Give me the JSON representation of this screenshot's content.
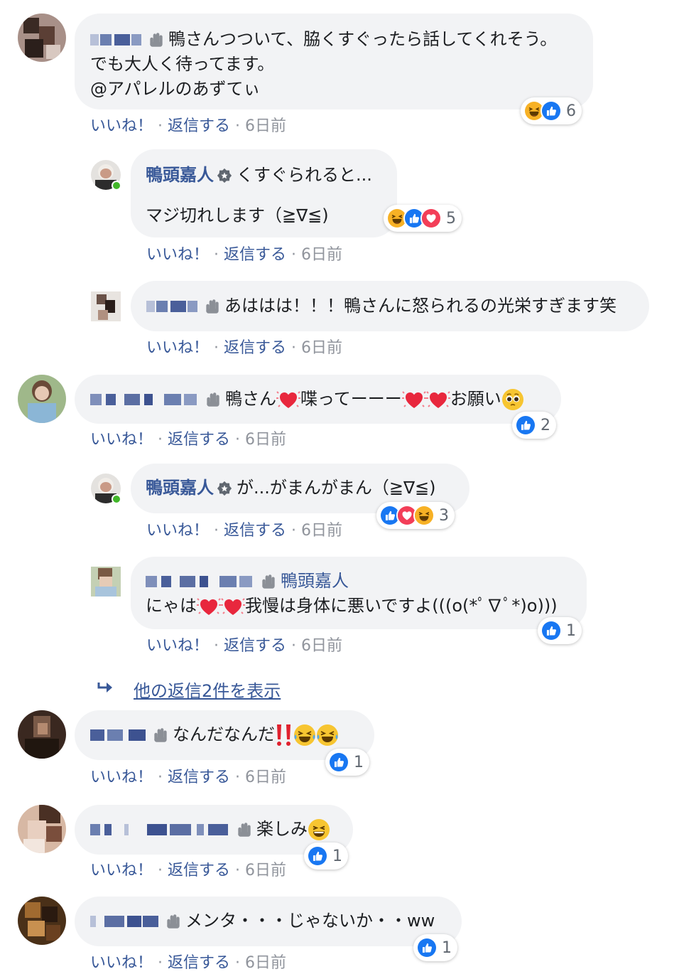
{
  "colors": {
    "link": "#385898",
    "meta": "#90949c",
    "bubble": "#f2f3f5",
    "like": "#1877f2",
    "love": "#f33e58",
    "haha": "#f7b125",
    "online": "#42b72a"
  },
  "actions": {
    "like_label": "いいね！",
    "reply_label": "返信する",
    "separator": "·",
    "time": "6日前"
  },
  "comments": [
    {
      "line1": "鴨さんつついて、脇くすぐったら話してくれそう。",
      "line2": "でも大人く待ってます。",
      "line3": "@アパレルのあずてぃ",
      "reaction_count": "6",
      "reaction_icons": [
        "haha",
        "like"
      ]
    },
    {
      "author": "鴨頭嘉人",
      "line1": "くすぐられると...",
      "line2": "マジ切れします（≧∇≦)",
      "reaction_count": "5",
      "reaction_icons": [
        "haha",
        "like",
        "love"
      ]
    },
    {
      "text": "あははは！！！鴨さんに怒られるの光栄すぎます笑"
    },
    {
      "text_a": "鴨さん",
      "text_b": "喋ってーーー",
      "text_c": "お願い",
      "reaction_count": "2",
      "reaction_icons": [
        "like"
      ]
    },
    {
      "author": "鴨頭嘉人",
      "text": "が...がまんがまん（≧∇≦)",
      "reaction_count": "3",
      "reaction_icons": [
        "like",
        "love",
        "haha"
      ]
    },
    {
      "mention": "鴨頭嘉人",
      "text_a": "にゃは",
      "text_b": "我慢は身体に悪いですよ(((o(*ﾟ∇ﾟ*)o)))",
      "reaction_count": "1",
      "reaction_icons": [
        "like"
      ]
    },
    {
      "text": "なんだなんだ",
      "reaction_count": "1",
      "reaction_icons": [
        "like"
      ]
    },
    {
      "text": "楽しみ",
      "reaction_count": "1",
      "reaction_icons": [
        "like"
      ]
    },
    {
      "text": "メンタ・・・じゃないか・・ww",
      "reaction_count": "1",
      "reaction_icons": [
        "like"
      ]
    }
  ],
  "more_replies": "他の返信2件を表示"
}
